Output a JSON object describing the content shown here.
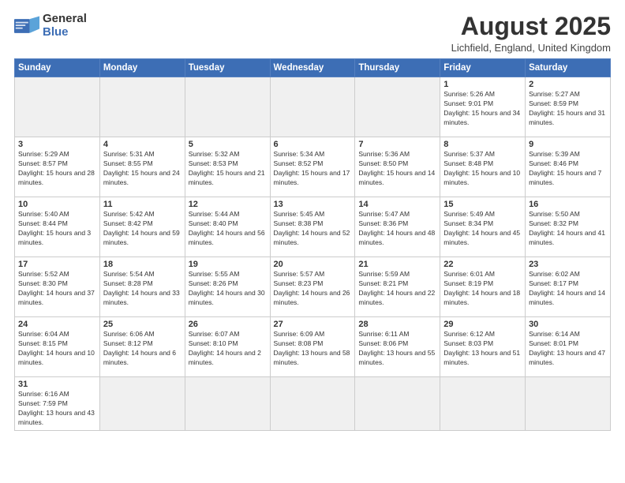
{
  "header": {
    "logo_general": "General",
    "logo_blue": "Blue",
    "month_title": "August 2025",
    "subtitle": "Lichfield, England, United Kingdom"
  },
  "days_of_week": [
    "Sunday",
    "Monday",
    "Tuesday",
    "Wednesday",
    "Thursday",
    "Friday",
    "Saturday"
  ],
  "weeks": [
    [
      {
        "day": "",
        "info": ""
      },
      {
        "day": "",
        "info": ""
      },
      {
        "day": "",
        "info": ""
      },
      {
        "day": "",
        "info": ""
      },
      {
        "day": "",
        "info": ""
      },
      {
        "day": "1",
        "info": "Sunrise: 5:26 AM\nSunset: 9:01 PM\nDaylight: 15 hours and 34 minutes."
      },
      {
        "day": "2",
        "info": "Sunrise: 5:27 AM\nSunset: 8:59 PM\nDaylight: 15 hours and 31 minutes."
      }
    ],
    [
      {
        "day": "3",
        "info": "Sunrise: 5:29 AM\nSunset: 8:57 PM\nDaylight: 15 hours and 28 minutes."
      },
      {
        "day": "4",
        "info": "Sunrise: 5:31 AM\nSunset: 8:55 PM\nDaylight: 15 hours and 24 minutes."
      },
      {
        "day": "5",
        "info": "Sunrise: 5:32 AM\nSunset: 8:53 PM\nDaylight: 15 hours and 21 minutes."
      },
      {
        "day": "6",
        "info": "Sunrise: 5:34 AM\nSunset: 8:52 PM\nDaylight: 15 hours and 17 minutes."
      },
      {
        "day": "7",
        "info": "Sunrise: 5:36 AM\nSunset: 8:50 PM\nDaylight: 15 hours and 14 minutes."
      },
      {
        "day": "8",
        "info": "Sunrise: 5:37 AM\nSunset: 8:48 PM\nDaylight: 15 hours and 10 minutes."
      },
      {
        "day": "9",
        "info": "Sunrise: 5:39 AM\nSunset: 8:46 PM\nDaylight: 15 hours and 7 minutes."
      }
    ],
    [
      {
        "day": "10",
        "info": "Sunrise: 5:40 AM\nSunset: 8:44 PM\nDaylight: 15 hours and 3 minutes."
      },
      {
        "day": "11",
        "info": "Sunrise: 5:42 AM\nSunset: 8:42 PM\nDaylight: 14 hours and 59 minutes."
      },
      {
        "day": "12",
        "info": "Sunrise: 5:44 AM\nSunset: 8:40 PM\nDaylight: 14 hours and 56 minutes."
      },
      {
        "day": "13",
        "info": "Sunrise: 5:45 AM\nSunset: 8:38 PM\nDaylight: 14 hours and 52 minutes."
      },
      {
        "day": "14",
        "info": "Sunrise: 5:47 AM\nSunset: 8:36 PM\nDaylight: 14 hours and 48 minutes."
      },
      {
        "day": "15",
        "info": "Sunrise: 5:49 AM\nSunset: 8:34 PM\nDaylight: 14 hours and 45 minutes."
      },
      {
        "day": "16",
        "info": "Sunrise: 5:50 AM\nSunset: 8:32 PM\nDaylight: 14 hours and 41 minutes."
      }
    ],
    [
      {
        "day": "17",
        "info": "Sunrise: 5:52 AM\nSunset: 8:30 PM\nDaylight: 14 hours and 37 minutes."
      },
      {
        "day": "18",
        "info": "Sunrise: 5:54 AM\nSunset: 8:28 PM\nDaylight: 14 hours and 33 minutes."
      },
      {
        "day": "19",
        "info": "Sunrise: 5:55 AM\nSunset: 8:26 PM\nDaylight: 14 hours and 30 minutes."
      },
      {
        "day": "20",
        "info": "Sunrise: 5:57 AM\nSunset: 8:23 PM\nDaylight: 14 hours and 26 minutes."
      },
      {
        "day": "21",
        "info": "Sunrise: 5:59 AM\nSunset: 8:21 PM\nDaylight: 14 hours and 22 minutes."
      },
      {
        "day": "22",
        "info": "Sunrise: 6:01 AM\nSunset: 8:19 PM\nDaylight: 14 hours and 18 minutes."
      },
      {
        "day": "23",
        "info": "Sunrise: 6:02 AM\nSunset: 8:17 PM\nDaylight: 14 hours and 14 minutes."
      }
    ],
    [
      {
        "day": "24",
        "info": "Sunrise: 6:04 AM\nSunset: 8:15 PM\nDaylight: 14 hours and 10 minutes."
      },
      {
        "day": "25",
        "info": "Sunrise: 6:06 AM\nSunset: 8:12 PM\nDaylight: 14 hours and 6 minutes."
      },
      {
        "day": "26",
        "info": "Sunrise: 6:07 AM\nSunset: 8:10 PM\nDaylight: 14 hours and 2 minutes."
      },
      {
        "day": "27",
        "info": "Sunrise: 6:09 AM\nSunset: 8:08 PM\nDaylight: 13 hours and 58 minutes."
      },
      {
        "day": "28",
        "info": "Sunrise: 6:11 AM\nSunset: 8:06 PM\nDaylight: 13 hours and 55 minutes."
      },
      {
        "day": "29",
        "info": "Sunrise: 6:12 AM\nSunset: 8:03 PM\nDaylight: 13 hours and 51 minutes."
      },
      {
        "day": "30",
        "info": "Sunrise: 6:14 AM\nSunset: 8:01 PM\nDaylight: 13 hours and 47 minutes."
      }
    ],
    [
      {
        "day": "31",
        "info": "Sunrise: 6:16 AM\nSunset: 7:59 PM\nDaylight: 13 hours and 43 minutes."
      },
      {
        "day": "",
        "info": ""
      },
      {
        "day": "",
        "info": ""
      },
      {
        "day": "",
        "info": ""
      },
      {
        "day": "",
        "info": ""
      },
      {
        "day": "",
        "info": ""
      },
      {
        "day": "",
        "info": ""
      }
    ]
  ]
}
